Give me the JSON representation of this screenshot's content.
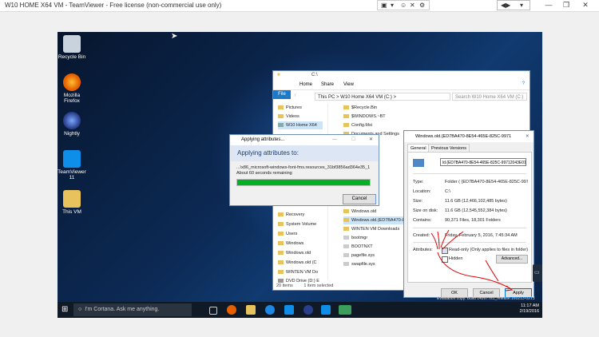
{
  "teamviewer": {
    "title": "W10 HOME X64 VM - TeamViewer - Free license (non-commercial use only)",
    "toolbar_icons": [
      "screen-icon",
      "dropdown-icon",
      "user-icon",
      "close-icon",
      "arrows-icon",
      "restore-icon"
    ],
    "window_controls": [
      "minimize-icon",
      "restore-icon",
      "close-icon"
    ]
  },
  "desktop": {
    "icons": [
      {
        "label": "Recycle Bin",
        "color": "#c9d3de"
      },
      {
        "label": "Mozilla Firefox",
        "color": "#e66000"
      },
      {
        "label": "Nightly",
        "color": "#2a63b3"
      },
      {
        "label": "TeamViewer 11",
        "color": "#0e8ee9"
      },
      {
        "label": "This VM",
        "color": "#e8c35d"
      }
    ]
  },
  "explorer": {
    "title": "C:\\",
    "ribbon_tabs": [
      "File",
      "Home",
      "Share",
      "View"
    ],
    "address": "This PC  >  W10 Home X64 VM (C:)  >",
    "search_placeholder": "Search W10 Home X64 VM (C:)",
    "nav_items": [
      "Pictures",
      "Videos",
      "W10 Home X64",
      "Recovery",
      "System Volume",
      "Users",
      "Windows",
      "Windows.old",
      "Windows.old (C",
      "WINTEN VM Do",
      "DVD Drive (D:) E"
    ],
    "files_top": [
      "$Recycle.Bin",
      "$WINDOWS.~BT",
      "Config.Msi",
      "Documents and Settings"
    ],
    "files_bottom": [
      "Windows.old",
      "Windows.old.(ED7BA470-8E54...",
      "WINTEN VM Downloads",
      "bootmgr",
      "BOOTNXT",
      "pagefile.sys",
      "swapfile.sys"
    ],
    "status_items": "20 items",
    "status_selected": "1 item selected"
  },
  "progress_dialog": {
    "title": "Applying attributes...",
    "heading": "Applying attributes to:",
    "file": "...\\x86_microsoft-windows-font-fms.resources_31bf3856ad364e35_1",
    "time": "About 60 seconds remaining",
    "progress": 1.0,
    "cancel": "Cancel"
  },
  "properties": {
    "title": "Windows.old.{ED7BA470-8E54-465E-825C-99712043E01C}...",
    "tabs": [
      "General",
      "Previous Versions"
    ],
    "name": "ld.{ED7BA470-8E54-465E-825C-99712043E01C}",
    "type_label": "Type:",
    "type_value": "Folder ( {ED7BA470-8E54-465E-825C-99712043E01",
    "location_label": "Location:",
    "location_value": "C:\\",
    "size_label": "Size:",
    "size_value": "11.6 GB (12,466,102,485 bytes)",
    "size_disk_label": "Size on disk:",
    "size_disk_value": "11.6 GB (12,545,552,384 bytes)",
    "contains_label": "Contains:",
    "contains_value": "90,371 Files, 18,301 Folders",
    "created_label": "Created:",
    "created_value": "Friday, February 5, 2016, 7:45:34 AM",
    "attributes_label": "Attributes:",
    "readonly_label": "Read-only (Only applies to files in folder)",
    "hidden_label": "Hidden",
    "advanced": "Advanced...",
    "ok": "OK",
    "cancel": "Cancel",
    "apply": "Apply"
  },
  "taskbar": {
    "cortana": "I'm Cortana. Ask me anything.",
    "evaluation": "Evaluation copy. Build 14267.rs1_release.160213-0213",
    "time": "11:17 AM",
    "date": "2/19/2016"
  }
}
